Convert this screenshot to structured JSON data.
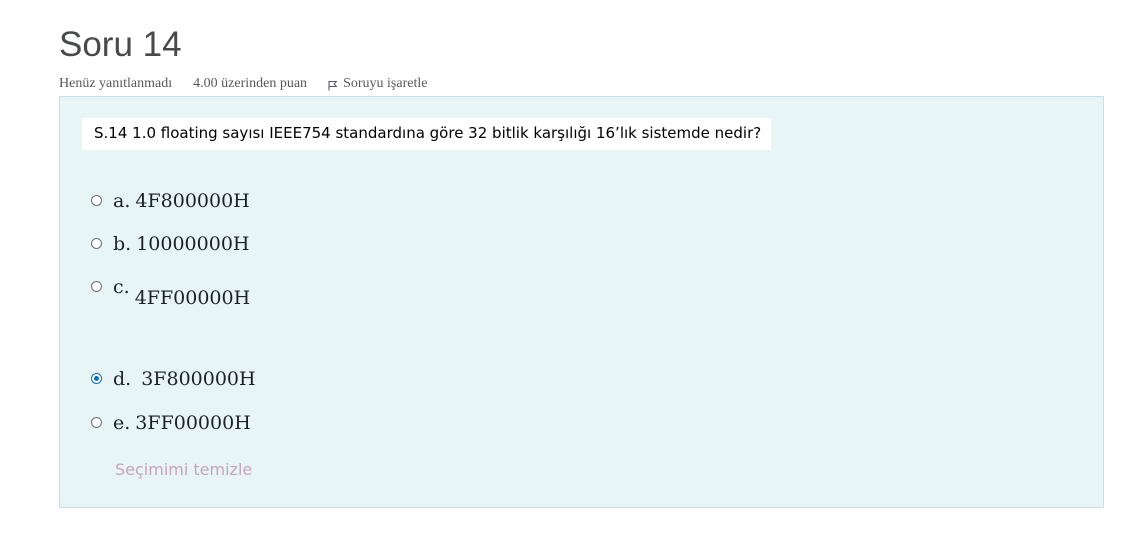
{
  "question": {
    "title": "Soru 14",
    "state": "Henüz yanıtlanmadı",
    "grade": "4.00 üzerinden puan",
    "flag_label": "Soruyu işaretle",
    "text": "S.14 1.0 floating sayısı IEEE754 standardına göre 32 bitlik karşılığı 16’lık sistemde nedir?"
  },
  "options": [
    {
      "letter": "a.",
      "value": "4F800000H",
      "selected": false
    },
    {
      "letter": "b.",
      "value": "10000000H",
      "selected": false
    },
    {
      "letter": "c.",
      "value": "4FF00000H",
      "selected": false
    },
    {
      "letter": "d.",
      "value": "3F800000H",
      "selected": true
    },
    {
      "letter": "e.",
      "value": "3FF00000H",
      "selected": false
    }
  ],
  "clear_choice_label": "Seçimimi temizle",
  "colors": {
    "content_bg": "#e7f5f6",
    "content_border": "#bfe3e6",
    "selected_radio": "#0f6cbf",
    "clear_link": "#c9a3bd"
  }
}
